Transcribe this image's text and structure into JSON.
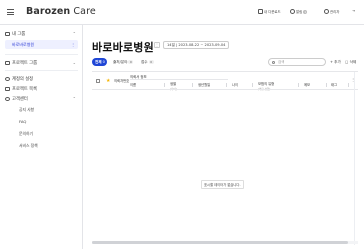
{
  "app": {
    "brand_prefix": "Barozen",
    "brand_suffix": " Care"
  },
  "topbar": {
    "download_label": "내 다운로드",
    "notice_label": "알림",
    "notice_count": "1",
    "user_label": "관리자"
  },
  "sidebar": {
    "group1": "내 그룹",
    "active_item": "바로바로병원",
    "group2": "프로젝트 그룹",
    "item_settings": "계정의 설정",
    "item_projects": "프로젝트 목록",
    "group3": "고객센터",
    "sub_items": [
      "공지 사항",
      "FAQ",
      "문의하기",
      "서비스 정책"
    ]
  },
  "main": {
    "title": "바로바로병원",
    "date_range": "14일  |  2023-08-22 ~ 2023-09-04",
    "pill_label": "전체",
    "pill_count": "0",
    "filter1": "출처/분야",
    "filter1_count": "0",
    "filter2": "접수",
    "filter2_count": "0",
    "search_placeholder": "검색",
    "add_button": "+ 추가",
    "delete_button": "삭제"
  },
  "table": {
    "group_header": "의뢰서 정보",
    "columns": [
      {
        "label": "의뢰자번호",
        "sub": ""
      },
      {
        "label": "이름",
        "sub": ""
      },
      {
        "label": "생별",
        "sub": "(나이)"
      },
      {
        "label": "생년월일",
        "sub": ""
      },
      {
        "label": "나이",
        "sub": ""
      },
      {
        "label": "보험의 유형",
        "sub": "(의료 보험)"
      },
      {
        "label": "메모",
        "sub": ""
      },
      {
        "label": "태그",
        "sub": ""
      }
    ],
    "empty_message": "표시할 데이터가 없습니다."
  },
  "colors": {
    "accent": "#1f46d6",
    "active_bg": "#eef0ff",
    "star": "#f5b400"
  }
}
